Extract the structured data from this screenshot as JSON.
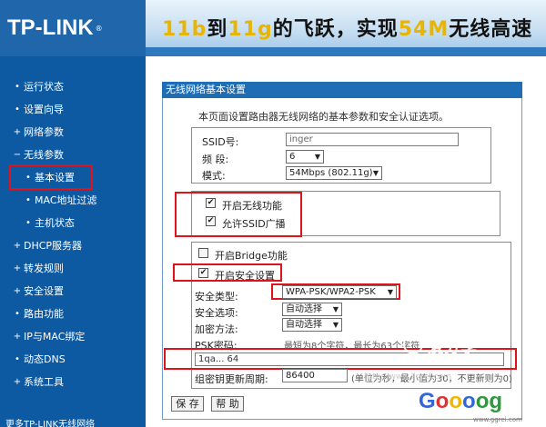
{
  "header": {
    "logo": "TP-LINK",
    "trademark": "®",
    "banner_parts": [
      "11b",
      "到",
      "11g",
      "的飞跃，实现",
      "54M",
      "无线高速"
    ]
  },
  "sidebar": {
    "items": [
      {
        "label": "运行状态",
        "bullet": "•"
      },
      {
        "label": "设置向导",
        "bullet": "•"
      },
      {
        "label": "网络参数",
        "bullet": "+"
      },
      {
        "label": "无线参数",
        "bullet": "−"
      },
      {
        "label": "基本设置",
        "bullet": "•"
      },
      {
        "label": "MAC地址过滤",
        "bullet": "•"
      },
      {
        "label": "主机状态",
        "bullet": "•"
      },
      {
        "label": "DHCP服务器",
        "bullet": "+"
      },
      {
        "label": "转发规则",
        "bullet": "+"
      },
      {
        "label": "安全设置",
        "bullet": "+"
      },
      {
        "label": "路由功能",
        "bullet": "•"
      },
      {
        "label": "IP与MAC绑定",
        "bullet": "+"
      },
      {
        "label": "动态DNS",
        "bullet": "•"
      },
      {
        "label": "系统工具",
        "bullet": "+"
      }
    ],
    "footer": "更多TP-LINK无线网络"
  },
  "main": {
    "title": "无线网络基本设置",
    "description": "本页面设置路由器无线网络的基本参数和安全认证选项。",
    "ssid_label": "SSID号:",
    "ssid_value": "inger",
    "channel_label": "频  段:",
    "channel_value": "6",
    "mode_label": "模式:",
    "mode_value": "54Mbps (802.11g)",
    "enable_wireless": "开启无线功能",
    "allow_ssid_broadcast": "允许SSID广播",
    "enable_bridge": "开启Bridge功能",
    "enable_security": "开启安全设置",
    "security_type_label": "安全类型:",
    "security_type_value": "WPA-PSK/WPA2-PSK",
    "security_option_label": "安全选项:",
    "security_option_value": "自动选择",
    "encryption_label": "加密方法:",
    "encryption_value": "自动选择",
    "psk_label": "PSK密码:",
    "psk_hint": "最短为8个字符，最长为63个字符",
    "psk_value": "1qa... 64",
    "group_key_label": "组密钥更新周期:",
    "group_key_value": "86400",
    "group_key_hint": "(单位为秒，最小值为30，不更新则为0)",
    "save_button": "保 存",
    "help_button": "帮 助",
    "check_mark": "✔"
  },
  "watermark": {
    "brand": "爱分享",
    "url": "http://www.linrei.com",
    "logo_letters": [
      "G",
      "o",
      "o",
      "o",
      "o",
      "g"
    ],
    "logo_sub": "www.ggrei.com"
  },
  "colors": {
    "sidebar_bg": "#0d5aa3",
    "title_bar": "#1e6db5",
    "highlight_red": "#e0131b"
  }
}
